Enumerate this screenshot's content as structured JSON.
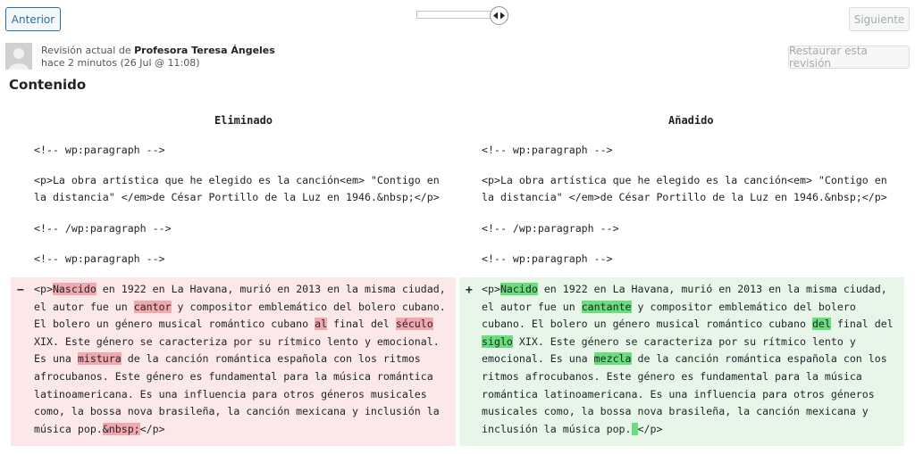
{
  "toolbar": {
    "prev_label": "Anterior",
    "next_label": "Siguiente",
    "restore_label": "Restaurar esta revisión"
  },
  "revision": {
    "prefix": "Revisión actual de ",
    "author": "Profesora Teresa Ángeles",
    "time": "hace 2 minutos (26 Jul @ 11:08)"
  },
  "section_title": "Contenido",
  "diff": {
    "removed_header": "Eliminado",
    "added_header": "Añadido",
    "context_lines": [
      "<!-- wp:paragraph -->",
      "<p>La obra artística que he elegido es la canción<em> \"Contigo en",
      "la distancia\" </em>de César Portillo de la Luz en 1946.&nbsp;</p>",
      "<!-- /wp:paragraph -->",
      "<!-- wp:paragraph -->"
    ],
    "removed_sign": "−",
    "added_sign": "+",
    "removed_lines": [
      [
        [
          "<p>",
          ""
        ],
        [
          "Nascido",
          "d"
        ],
        [
          " en 1922 en La Havana, murió en 2013 en la misma ciudad,",
          ""
        ]
      ],
      [
        [
          "el autor fue un ",
          ""
        ],
        [
          "cantor",
          "d"
        ],
        [
          " y compositor emblemático del bolero cubano.",
          ""
        ]
      ],
      [
        [
          "El bolero un género musical romántico cubano ",
          ""
        ],
        [
          "al",
          "d"
        ],
        [
          " final del ",
          ""
        ],
        [
          "século",
          "d"
        ]
      ],
      [
        [
          "XIX. Este género se caracteriza por su rítmico lento y emocional.",
          ""
        ]
      ],
      [
        [
          "Es una ",
          ""
        ],
        [
          "mistura",
          "d"
        ],
        [
          " de la canción romántica española con los ritmos",
          ""
        ]
      ],
      [
        [
          "afrocubanos. Este género es fundamental para la música romántica",
          ""
        ]
      ],
      [
        [
          "latinoamericana. Es una influencia para otros géneros musicales",
          ""
        ]
      ],
      [
        [
          "como, la bossa nova brasileña, la canción mexicana y inclusión la",
          ""
        ]
      ],
      [
        [
          "música pop.",
          ""
        ],
        [
          "&nbsp;",
          "d"
        ],
        [
          "</p>",
          ""
        ]
      ]
    ],
    "added_lines": [
      [
        [
          "<p>",
          ""
        ],
        [
          "Nacido",
          "a"
        ],
        [
          " en 1922 en La Havana, murió en 2013 en la misma ciudad,",
          ""
        ]
      ],
      [
        [
          "el autor fue un ",
          ""
        ],
        [
          "cantante",
          "a"
        ],
        [
          " y compositor emblemático del bolero",
          ""
        ]
      ],
      [
        [
          "cubano. El bolero un género musical romántico cubano ",
          ""
        ],
        [
          "del",
          "a"
        ],
        [
          " final del",
          ""
        ]
      ],
      [
        [
          "",
          ""
        ],
        [
          "siglo",
          "a"
        ],
        [
          " XIX. Este género se caracteriza por su rítmico lento y",
          ""
        ]
      ],
      [
        [
          "emocional. Es una ",
          ""
        ],
        [
          "mezcla",
          "a"
        ],
        [
          " de la canción romántica española con los",
          ""
        ]
      ],
      [
        [
          "ritmos afrocubanos. Este género es fundamental para la música",
          ""
        ]
      ],
      [
        [
          "romántica latinoamericana. Es una influencia para otros géneros",
          ""
        ]
      ],
      [
        [
          "musicales como, la bossa nova brasileña, la canción mexicana y",
          ""
        ]
      ],
      [
        [
          "inclusión la música pop.",
          ""
        ],
        [
          " ",
          "a"
        ],
        [
          "</p>",
          ""
        ]
      ]
    ]
  }
}
